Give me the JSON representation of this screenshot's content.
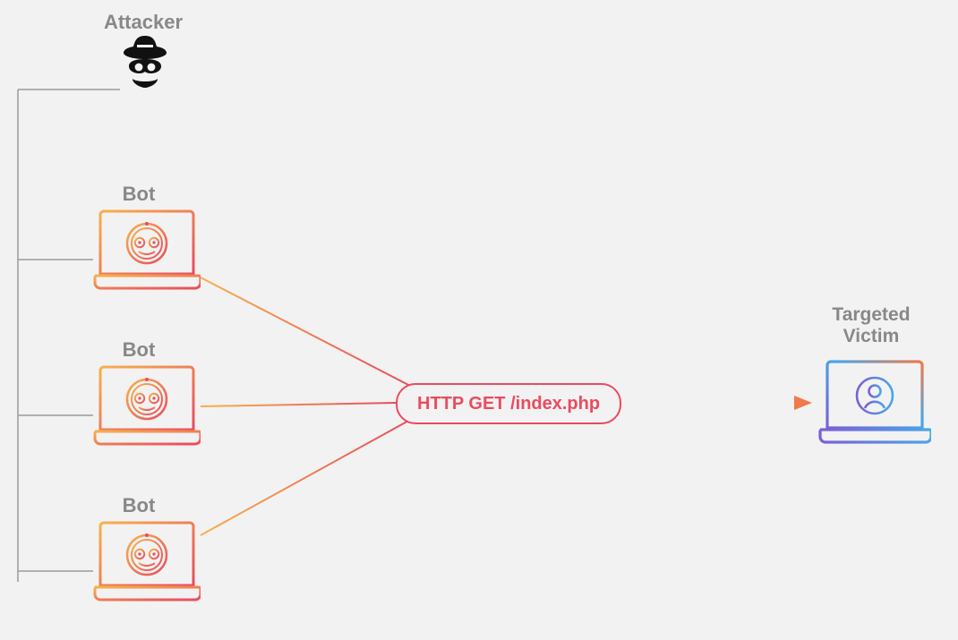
{
  "labels": {
    "attacker": "Attacker",
    "bot": "Bot",
    "victim_line1": "Targeted",
    "victim_line2": "Victim"
  },
  "attack": {
    "request_text": "HTTP GET /index.php"
  },
  "colors": {
    "label": "#888888",
    "pill_border": "#e94b5f",
    "pill_text": "#e94b5f",
    "grad_start": "#f6b24b",
    "grad_end": "#e94b5f",
    "victim_grad_start": "#4aa6e8",
    "victim_grad_mid": "#7c5fd6",
    "victim_grad_end": "#f07a4a"
  }
}
